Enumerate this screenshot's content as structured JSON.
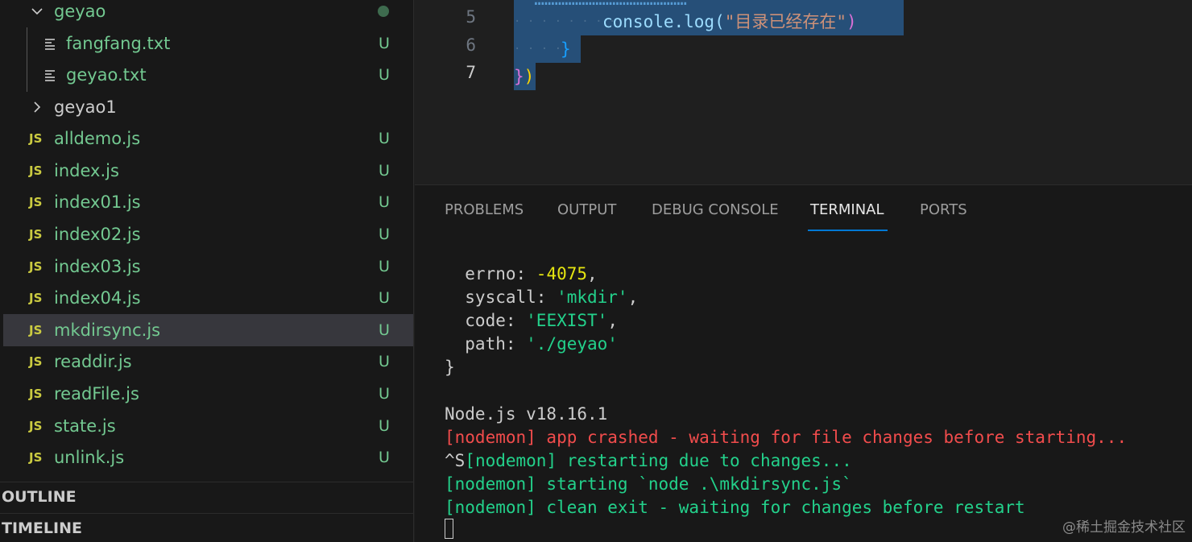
{
  "explorer": {
    "items": [
      {
        "name": "geyao",
        "kind": "folder-open",
        "status": "dot"
      },
      {
        "name": "fangfang.txt",
        "kind": "txt",
        "status": "U"
      },
      {
        "name": "geyao.txt",
        "kind": "txt",
        "status": "U"
      },
      {
        "name": "geyao1",
        "kind": "folder-closed",
        "status": ""
      },
      {
        "name": "alldemo.js",
        "kind": "js",
        "status": "U"
      },
      {
        "name": "index.js",
        "kind": "js",
        "status": "U"
      },
      {
        "name": "index01.js",
        "kind": "js",
        "status": "U"
      },
      {
        "name": "index02.js",
        "kind": "js",
        "status": "U"
      },
      {
        "name": "index03.js",
        "kind": "js",
        "status": "U"
      },
      {
        "name": "index04.js",
        "kind": "js",
        "status": "U"
      },
      {
        "name": "mkdirsync.js",
        "kind": "js",
        "status": "U",
        "selected": true
      },
      {
        "name": "readdir.js",
        "kind": "js",
        "status": "U"
      },
      {
        "name": "readFile.js",
        "kind": "js",
        "status": "U"
      },
      {
        "name": "state.js",
        "kind": "js",
        "status": "U"
      },
      {
        "name": "unlink.js",
        "kind": "js",
        "status": "U"
      }
    ],
    "js_badge": "JS",
    "outline_label": "OUTLINE",
    "timeline_label": "TIMELINE"
  },
  "editor": {
    "line_numbers": [
      "5",
      "6",
      "7"
    ],
    "line5_method": "console.log(",
    "line5_string": "\"目录已经存在\"",
    "line5_close": ")",
    "line6_brace": "}",
    "line7_brace": "}",
    "line7_paren": ")"
  },
  "panel": {
    "tabs": [
      "PROBLEMS",
      "OUTPUT",
      "DEBUG CONSOLE",
      "TERMINAL",
      "PORTS"
    ],
    "active_tab": "TERMINAL"
  },
  "terminal": {
    "errno_key": "  errno: ",
    "errno_val": "-4075",
    "syscall_key": "  syscall: ",
    "syscall_val": "'mkdir'",
    "code_key": "  code: ",
    "code_val": "'EEXIST'",
    "path_key": "  path: ",
    "path_val": "'./geyao'",
    "close_brace": "}",
    "node_version": "Node.js v18.16.1",
    "crash_msg": "[nodemon] app crashed - waiting for file changes before starting...",
    "ctrl_s": "^S",
    "restart_msg": "[nodemon] restarting due to changes...",
    "start_msg": "[nodemon] starting `node .\\mkdirsync.js`",
    "exit_msg": "[nodemon] clean exit - waiting for changes before restart",
    "comma": ","
  },
  "watermark": "@稀土掘金技术社区",
  "colors": {
    "untracked_green": "#73c991",
    "js_yellow": "#cbcb41",
    "selection": "#264f78",
    "terminal_red": "#f14c4c",
    "terminal_green": "#23d18b",
    "accent_blue": "#0078d4"
  }
}
